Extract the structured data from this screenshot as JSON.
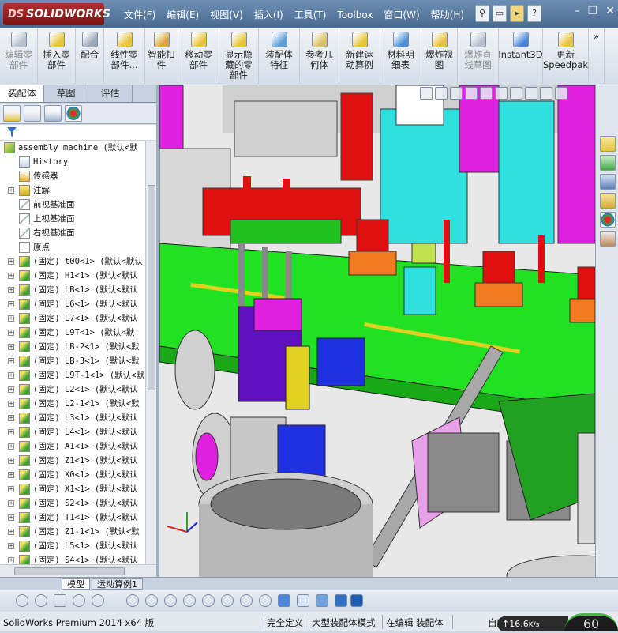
{
  "app": {
    "brand": "SOLIDWORKS",
    "menus": [
      "文件(F)",
      "编辑(E)",
      "视图(V)",
      "插入(I)",
      "工具(T)",
      "Toolbox",
      "窗口(W)",
      "帮助(H)"
    ]
  },
  "commands": [
    {
      "label": "编辑零\n部件",
      "icon": "edit-component-icon",
      "disabled": true
    },
    {
      "label": "插入零\n部件",
      "icon": "insert-component-icon",
      "disabled": false
    },
    {
      "label": "配合",
      "icon": "mate-icon",
      "disabled": false
    },
    {
      "label": "线性零\n部件...",
      "icon": "linear-pattern-icon",
      "disabled": false
    },
    {
      "label": "智能扣\n件",
      "icon": "smart-fastener-icon",
      "disabled": false
    },
    {
      "label": "移动零\n部件",
      "icon": "move-component-icon",
      "disabled": false
    },
    {
      "label": "显示隐\n藏的零\n部件",
      "icon": "show-hidden-icon",
      "disabled": false
    },
    {
      "label": "装配体\n特征",
      "icon": "assembly-feature-icon",
      "disabled": false
    },
    {
      "label": "参考几\n何体",
      "icon": "reference-geometry-icon",
      "disabled": false
    },
    {
      "label": "新建运\n动算例",
      "icon": "motion-study-icon",
      "disabled": false
    },
    {
      "label": "材料明\n细表",
      "icon": "bom-icon",
      "disabled": false
    },
    {
      "label": "爆炸视\n图",
      "icon": "exploded-view-icon",
      "disabled": false
    },
    {
      "label": "爆炸直\n线草图",
      "icon": "explode-line-icon",
      "disabled": true
    },
    {
      "label": "Instant3D",
      "icon": "instant3d-icon",
      "disabled": false
    },
    {
      "label": "更新\nSpeedpak",
      "icon": "speedpak-icon",
      "disabled": false
    }
  ],
  "left_tabs": [
    "装配体",
    "草图",
    "评估"
  ],
  "tree": {
    "root": "assembly machine  (默认<默",
    "items": [
      {
        "label": "History",
        "icon": "history-icon",
        "expand": false
      },
      {
        "label": "传感器",
        "icon": "sensor-icon",
        "expand": false
      },
      {
        "label": "注解",
        "icon": "annotation-icon",
        "expand": true
      },
      {
        "label": "前视基准面",
        "icon": "plane-icon",
        "expand": false
      },
      {
        "label": "上视基准面",
        "icon": "plane-icon",
        "expand": false
      },
      {
        "label": "右视基准面",
        "icon": "plane-icon",
        "expand": false
      },
      {
        "label": "原点",
        "icon": "origin-icon",
        "expand": false
      },
      {
        "label": "(固定) t00<1> (默认<默认",
        "icon": "part-icon",
        "expand": true
      },
      {
        "label": "(固定) H1<1> (默认<默认",
        "icon": "part-icon",
        "expand": true
      },
      {
        "label": "(固定) LB<1> (默认<默认",
        "icon": "part-icon",
        "expand": true
      },
      {
        "label": "(固定) L6<1> (默认<默认",
        "icon": "part-icon",
        "expand": true
      },
      {
        "label": "(固定) L7<1> (默认<默认",
        "icon": "part-icon",
        "expand": true
      },
      {
        "label": "(固定) L9T<1> (默认<默",
        "icon": "part-icon",
        "expand": true
      },
      {
        "label": "(固定) LB-2<1> (默认<默",
        "icon": "part-icon",
        "expand": true
      },
      {
        "label": "(固定) LB-3<1> (默认<默",
        "icon": "part-icon",
        "expand": true
      },
      {
        "label": "(固定) L9T-1<1> (默认<默",
        "icon": "part-icon",
        "expand": true
      },
      {
        "label": "(固定) L2<1> (默认<默认",
        "icon": "part-icon",
        "expand": true
      },
      {
        "label": "(固定) L2-1<1> (默认<默",
        "icon": "part-icon",
        "expand": true
      },
      {
        "label": "(固定) L3<1> (默认<默认",
        "icon": "part-icon",
        "expand": true
      },
      {
        "label": "(固定) L4<1> (默认<默认",
        "icon": "part-icon",
        "expand": true
      },
      {
        "label": "(固定) A1<1> (默认<默认",
        "icon": "part-icon",
        "expand": true
      },
      {
        "label": "(固定) Z1<1> (默认<默认",
        "icon": "part-icon",
        "expand": true
      },
      {
        "label": "(固定) X0<1> (默认<默认",
        "icon": "part-icon",
        "expand": true
      },
      {
        "label": "(固定) X1<1> (默认<默认",
        "icon": "part-icon",
        "expand": true
      },
      {
        "label": "(固定) S2<1> (默认<默认",
        "icon": "part-icon",
        "expand": true
      },
      {
        "label": "(固定) T1<1> (默认<默认",
        "icon": "part-icon",
        "expand": true
      },
      {
        "label": "(固定) Z1-1<1> (默认<默",
        "icon": "part-icon",
        "expand": true
      },
      {
        "label": "(固定) L5<1> (默认<默认",
        "icon": "part-icon",
        "expand": true
      },
      {
        "label": "(固定) S4<1> (默认<默认",
        "icon": "part-icon",
        "expand": true
      }
    ]
  },
  "bottom_tabs": {
    "model": "模型",
    "motion": "运动算例1"
  },
  "status": {
    "app_version": "SolidWorks Premium 2014 x64 版",
    "defined": "完全定义",
    "mode": "大型装配体模式",
    "editing": "在编辑 装配体",
    "custom": "自定义",
    "net_speed": "16.6",
    "net_unit": "K/s",
    "gauge": "60"
  },
  "colors": {
    "accent": "#48698f",
    "logo": "#9a1e1e",
    "green_plate": "#22dd22",
    "magenta": "#dd22dd",
    "cyan": "#33dddd",
    "red": "#dd1111"
  }
}
